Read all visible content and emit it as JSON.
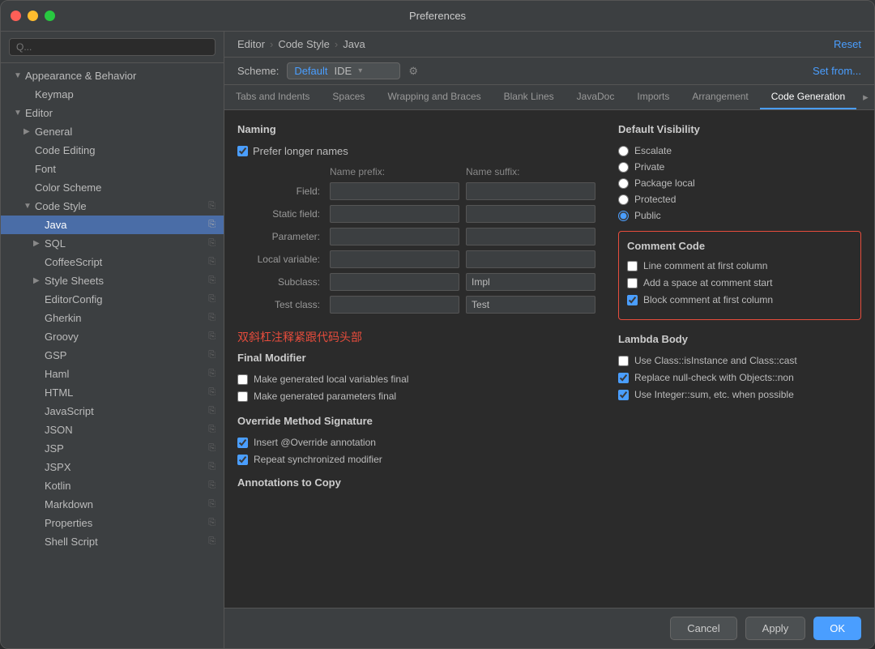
{
  "window": {
    "title": "Preferences"
  },
  "sidebar": {
    "search_placeholder": "Q...",
    "items": [
      {
        "id": "appearance",
        "label": "Appearance & Behavior",
        "level": 0,
        "expanded": true,
        "arrow": "▼"
      },
      {
        "id": "keymap",
        "label": "Keymap",
        "level": 1,
        "arrow": ""
      },
      {
        "id": "editor",
        "label": "Editor",
        "level": 0,
        "expanded": true,
        "arrow": "▼"
      },
      {
        "id": "general",
        "label": "General",
        "level": 1,
        "arrow": "▶"
      },
      {
        "id": "code-editing",
        "label": "Code Editing",
        "level": 1,
        "arrow": ""
      },
      {
        "id": "font",
        "label": "Font",
        "level": 1,
        "arrow": ""
      },
      {
        "id": "color-scheme",
        "label": "Color Scheme",
        "level": 1,
        "arrow": ""
      },
      {
        "id": "code-style",
        "label": "Code Style",
        "level": 1,
        "expanded": true,
        "arrow": "▼"
      },
      {
        "id": "java",
        "label": "Java",
        "level": 2,
        "arrow": "",
        "selected": true
      },
      {
        "id": "sql",
        "label": "SQL",
        "level": 2,
        "arrow": "▶"
      },
      {
        "id": "coffeescript",
        "label": "CoffeeScript",
        "level": 2,
        "arrow": ""
      },
      {
        "id": "style-sheets",
        "label": "Style Sheets",
        "level": 2,
        "arrow": "▶"
      },
      {
        "id": "editorconfig",
        "label": "EditorConfig",
        "level": 2,
        "arrow": ""
      },
      {
        "id": "gherkin",
        "label": "Gherkin",
        "level": 2,
        "arrow": ""
      },
      {
        "id": "groovy",
        "label": "Groovy",
        "level": 2,
        "arrow": ""
      },
      {
        "id": "gsp",
        "label": "GSP",
        "level": 2,
        "arrow": ""
      },
      {
        "id": "haml",
        "label": "Haml",
        "level": 2,
        "arrow": ""
      },
      {
        "id": "html",
        "label": "HTML",
        "level": 2,
        "arrow": ""
      },
      {
        "id": "javascript",
        "label": "JavaScript",
        "level": 2,
        "arrow": ""
      },
      {
        "id": "json",
        "label": "JSON",
        "level": 2,
        "arrow": ""
      },
      {
        "id": "jsp",
        "label": "JSP",
        "level": 2,
        "arrow": ""
      },
      {
        "id": "jspx",
        "label": "JSPX",
        "level": 2,
        "arrow": ""
      },
      {
        "id": "kotlin",
        "label": "Kotlin",
        "level": 2,
        "arrow": ""
      },
      {
        "id": "markdown",
        "label": "Markdown",
        "level": 2,
        "arrow": ""
      },
      {
        "id": "properties",
        "label": "Properties",
        "level": 2,
        "arrow": ""
      },
      {
        "id": "shell-script",
        "label": "Shell Script",
        "level": 2,
        "arrow": ""
      }
    ]
  },
  "breadcrumb": {
    "parts": [
      "Editor",
      "Code Style",
      "Java"
    ]
  },
  "reset_label": "Reset",
  "scheme": {
    "label": "Scheme:",
    "default_text": "Default",
    "ide_text": "IDE",
    "gear_symbol": "⚙"
  },
  "set_from_label": "Set from...",
  "tabs": [
    {
      "id": "tabs-indents",
      "label": "Tabs and Indents"
    },
    {
      "id": "spaces",
      "label": "Spaces"
    },
    {
      "id": "wrapping",
      "label": "Wrapping and Braces"
    },
    {
      "id": "blank-lines",
      "label": "Blank Lines"
    },
    {
      "id": "javadoc",
      "label": "JavaDoc"
    },
    {
      "id": "imports",
      "label": "Imports"
    },
    {
      "id": "arrangement",
      "label": "Arrangement"
    },
    {
      "id": "code-generation",
      "label": "Code Generation",
      "active": true
    }
  ],
  "content": {
    "naming_title": "Naming",
    "prefer_longer_names": "Prefer longer names",
    "prefer_longer_checked": true,
    "name_prefix_label": "Name prefix:",
    "name_suffix_label": "Name suffix:",
    "rows": [
      {
        "label": "Field:",
        "prefix": "",
        "suffix": ""
      },
      {
        "label": "Static field:",
        "prefix": "",
        "suffix": ""
      },
      {
        "label": "Parameter:",
        "prefix": "",
        "suffix": ""
      },
      {
        "label": "Local variable:",
        "prefix": "",
        "suffix": ""
      },
      {
        "label": "Subclass:",
        "prefix": "",
        "suffix": "Impl"
      },
      {
        "label": "Test class:",
        "prefix": "",
        "suffix": "Test"
      }
    ],
    "annotation_text": "双斜杠注释紧跟代码头部",
    "final_modifier_title": "Final Modifier",
    "final_modifier_items": [
      {
        "label": "Make generated local variables final",
        "checked": false
      },
      {
        "label": "Make generated parameters final",
        "checked": false
      }
    ],
    "override_title": "Override Method Signature",
    "override_items": [
      {
        "label": "Insert @Override annotation",
        "checked": true
      },
      {
        "label": "Repeat synchronized modifier",
        "checked": true
      }
    ],
    "annotations_to_copy_title": "Annotations to Copy",
    "comment_code_title": "Comment Code",
    "comment_code_items": [
      {
        "label": "Line comment at first column",
        "checked": false,
        "highlighted": true
      },
      {
        "label": "Add a space at comment start",
        "checked": false
      },
      {
        "label": "Block comment at first column",
        "checked": true
      }
    ],
    "default_visibility_title": "Default Visibility",
    "visibility_options": [
      {
        "label": "Escalate",
        "selected": false
      },
      {
        "label": "Private",
        "selected": false
      },
      {
        "label": "Package local",
        "selected": false
      },
      {
        "label": "Protected",
        "selected": false
      },
      {
        "label": "Public",
        "selected": true
      }
    ],
    "lambda_body_title": "Lambda Body",
    "lambda_items": [
      {
        "label": "Use Class::isInstance and Class::cast",
        "checked": false
      },
      {
        "label": "Replace null-check with Objects::non",
        "checked": true
      },
      {
        "label": "Use Integer::sum, etc. when possible",
        "checked": true
      }
    ]
  },
  "buttons": {
    "cancel": "Cancel",
    "apply": "Apply",
    "ok": "OK"
  }
}
